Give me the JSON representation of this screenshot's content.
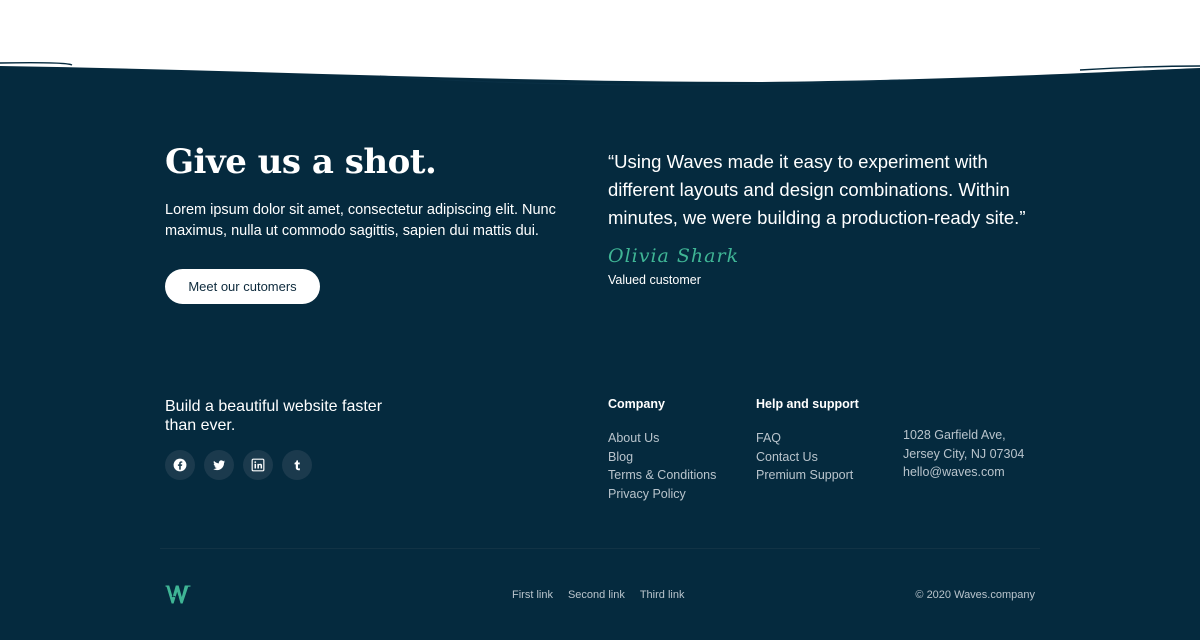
{
  "cta": {
    "title": "Give us a shot.",
    "text": "Lorem ipsum dolor sit amet, consectetur adipiscing elit. Nunc maximus, nulla ut commodo sagittis, sapien dui mattis dui.",
    "button_label": "Meet our cutomers"
  },
  "testimonial": {
    "quote": "“Using Waves made it easy to experiment with different layouts and design combinations. Within minutes, we were building a production-ready site.”",
    "name": "Olivia Shark",
    "role": "Valued customer"
  },
  "footer": {
    "tagline": "Build a beautiful website faster than ever.",
    "socials": [
      "facebook-icon",
      "twitter-icon",
      "linkedin-icon",
      "tumblr-icon"
    ],
    "company": {
      "title": "Company",
      "links": [
        "About Us",
        "Blog",
        "Terms & Conditions",
        "Privacy Policy"
      ]
    },
    "support": {
      "title": "Help and support",
      "links": [
        "FAQ",
        "Contact Us",
        "Premium Support"
      ]
    },
    "address": {
      "street": "1028 Garfield Ave,",
      "city": "Jersey City, NJ 07304",
      "email": "hello@waves.com"
    },
    "bottom_links": [
      "First link",
      "Second link",
      "Third link"
    ],
    "copyright": "© 2020 Waves.company"
  },
  "colors": {
    "background": "#052a3e",
    "accent": "#3fb595",
    "text": "#ffffff",
    "muted_text": "#b9c4cc",
    "social_circle": "#1b3a4d"
  }
}
